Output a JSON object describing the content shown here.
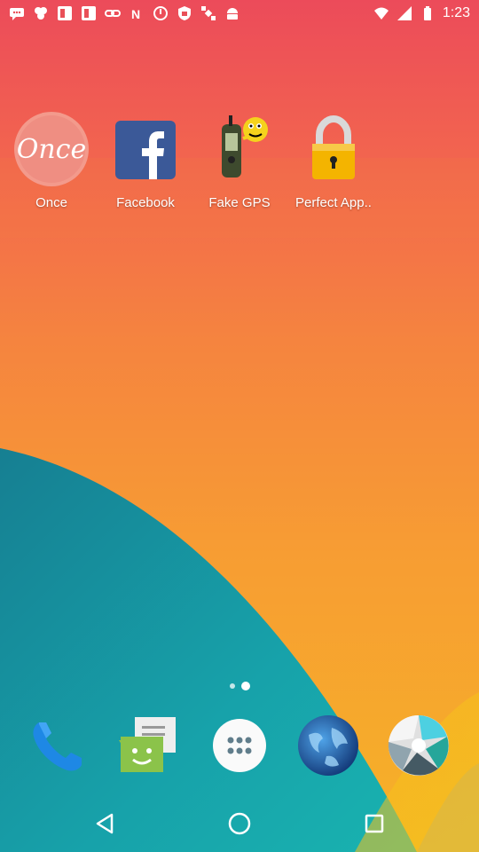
{
  "status_bar": {
    "time": "1:23",
    "icons": [
      "chat-icon",
      "bird-icon",
      "notification-box-icon",
      "notification-box-icon",
      "link-icon",
      "nfc-icon",
      "alarm-icon",
      "security-icon",
      "satellite-icon",
      "android-icon",
      "wifi-icon",
      "signal-icon",
      "battery-icon"
    ]
  },
  "home_apps": [
    {
      "label": "Once",
      "icon": "once-icon"
    },
    {
      "label": "Facebook",
      "icon": "facebook-icon"
    },
    {
      "label": "Fake GPS",
      "icon": "fake-gps-icon"
    },
    {
      "label": "Perfect App..",
      "icon": "padlock-icon"
    }
  ],
  "page_indicator": {
    "pages": 2,
    "current": 2
  },
  "dock": [
    {
      "icon": "phone-icon"
    },
    {
      "icon": "messenger-icon"
    },
    {
      "icon": "app-drawer-icon"
    },
    {
      "icon": "browser-globe-icon"
    },
    {
      "icon": "camera-shutter-icon"
    }
  ],
  "colors": {
    "wallpaper_top": "#ec4b5a",
    "wallpaper_bottom": "#f6b227",
    "teal_wave": "#169aa6",
    "yellow_wave": "#f6c11b"
  }
}
